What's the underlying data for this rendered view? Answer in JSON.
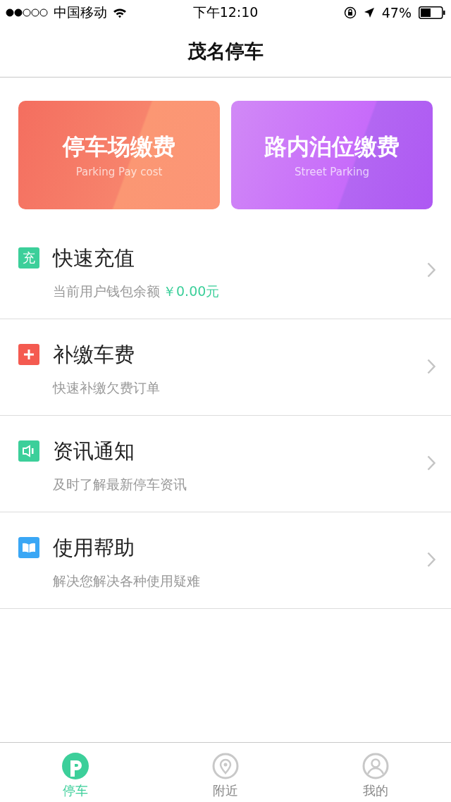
{
  "status_bar": {
    "carrier": "中国移动",
    "time": "下午12:10",
    "battery": "47%"
  },
  "nav": {
    "title": "茂名停车"
  },
  "cards": [
    {
      "kind": "orange",
      "title": "停车场缴费",
      "subtitle": "Parking Pay cost"
    },
    {
      "kind": "purple",
      "title": "路内泊位缴费",
      "subtitle": "Street Parking"
    }
  ],
  "menu": [
    {
      "kind": "recharge",
      "icon_text": "充",
      "title": "快速充值",
      "subtitle": "当前用户钱包余额",
      "amount": "￥0.00元"
    },
    {
      "kind": "plus",
      "title": "补缴车费",
      "subtitle": "快速补缴欠费订单"
    },
    {
      "kind": "speaker",
      "title": "资讯通知",
      "subtitle": "及时了解最新停车资讯"
    },
    {
      "kind": "book",
      "title": "使用帮助",
      "subtitle": "解决您解决各种使用疑难"
    }
  ],
  "tab_bar": [
    {
      "kind": "parking",
      "label": "停车",
      "selected": true
    },
    {
      "kind": "location",
      "label": "附近",
      "selected": false
    },
    {
      "kind": "profile",
      "label": "我的",
      "selected": false
    }
  ]
}
